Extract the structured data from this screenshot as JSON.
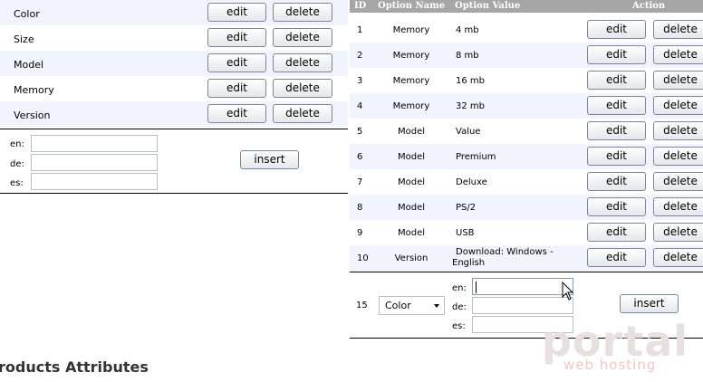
{
  "left_panel": {
    "rows": [
      {
        "name": "Color",
        "edit_label": "edit",
        "delete_label": "delete"
      },
      {
        "name": "Size",
        "edit_label": "edit",
        "delete_label": "delete"
      },
      {
        "name": "Model",
        "edit_label": "edit",
        "delete_label": "delete"
      },
      {
        "name": "Memory",
        "edit_label": "edit",
        "delete_label": "delete"
      },
      {
        "name": "Version",
        "edit_label": "edit",
        "delete_label": "delete"
      }
    ],
    "inputs": [
      {
        "label": "en:",
        "value": ""
      },
      {
        "label": "de:",
        "value": ""
      },
      {
        "label": "es:",
        "value": ""
      }
    ],
    "insert_label": "insert"
  },
  "right_panel": {
    "headers": {
      "id": "ID",
      "option_name": "Option Name",
      "option_value": "Option Value",
      "action": "Action"
    },
    "rows": [
      {
        "id": "1",
        "option_name": "Memory",
        "option_value": "4 mb",
        "edit_label": "edit",
        "delete_label": "delete"
      },
      {
        "id": "2",
        "option_name": "Memory",
        "option_value": "8 mb",
        "edit_label": "edit",
        "delete_label": "delete"
      },
      {
        "id": "3",
        "option_name": "Memory",
        "option_value": "16 mb",
        "edit_label": "edit",
        "delete_label": "delete"
      },
      {
        "id": "4",
        "option_name": "Memory",
        "option_value": "32 mb",
        "edit_label": "edit",
        "delete_label": "delete"
      },
      {
        "id": "5",
        "option_name": "Model",
        "option_value": "Value",
        "edit_label": "edit",
        "delete_label": "delete"
      },
      {
        "id": "6",
        "option_name": "Model",
        "option_value": "Premium",
        "edit_label": "edit",
        "delete_label": "delete"
      },
      {
        "id": "7",
        "option_name": "Model",
        "option_value": "Deluxe",
        "edit_label": "edit",
        "delete_label": "delete"
      },
      {
        "id": "8",
        "option_name": "Model",
        "option_value": "PS/2",
        "edit_label": "edit",
        "delete_label": "delete"
      },
      {
        "id": "9",
        "option_name": "Model",
        "option_value": "USB",
        "edit_label": "edit",
        "delete_label": "delete"
      },
      {
        "id": "10",
        "option_name": "Version",
        "option_value_line1": "Download: Windows -",
        "option_value_line2": "English",
        "edit_label": "edit",
        "delete_label": "delete"
      }
    ],
    "new_row": {
      "id": "15",
      "select_value": "Color",
      "inputs": [
        {
          "label": "en:",
          "value": ""
        },
        {
          "label": "de:",
          "value": ""
        },
        {
          "label": "es:",
          "value": ""
        }
      ],
      "insert_label": "insert"
    }
  },
  "section_heading": "roducts Attributes",
  "watermark": {
    "brand": "portal",
    "tagline": "web hosting",
    "color": "#e8e0e0",
    "tagline_color": "#f1c7c7"
  },
  "colors": {
    "header_bg": "#a6a6a6",
    "alt_row_bg": "#f1f4fc"
  }
}
